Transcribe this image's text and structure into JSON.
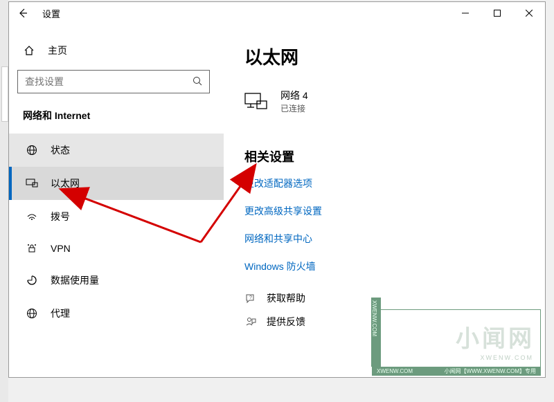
{
  "window": {
    "title": "设置",
    "controls": {
      "min": "—",
      "max": "▢",
      "close": "✕"
    }
  },
  "sidebar": {
    "home_label": "主页",
    "search_placeholder": "查找设置",
    "group_title": "网络和 Internet",
    "items": [
      {
        "icon": "status-icon",
        "label": "状态"
      },
      {
        "icon": "ethernet-icon",
        "label": "以太网"
      },
      {
        "icon": "dialup-icon",
        "label": "拨号"
      },
      {
        "icon": "vpn-icon",
        "label": "VPN"
      },
      {
        "icon": "data-usage-icon",
        "label": "数据使用量"
      },
      {
        "icon": "proxy-icon",
        "label": "代理"
      }
    ]
  },
  "content": {
    "heading": "以太网",
    "network": {
      "name": "网络 4",
      "status": "已连接"
    },
    "related_heading": "相关设置",
    "links": [
      "更改适配器选项",
      "更改高级共享设置",
      "网络和共享中心",
      "Windows 防火墙"
    ],
    "help": [
      {
        "icon": "help-icon",
        "label": "获取帮助"
      },
      {
        "icon": "feedback-icon",
        "label": "提供反馈"
      }
    ]
  },
  "watermark": {
    "text": "小闻网",
    "sub": "XWENW.COM",
    "bar_left": "XWENW.COM",
    "bar_right": "小闻网【WWW.XWENW.COM】专用"
  }
}
